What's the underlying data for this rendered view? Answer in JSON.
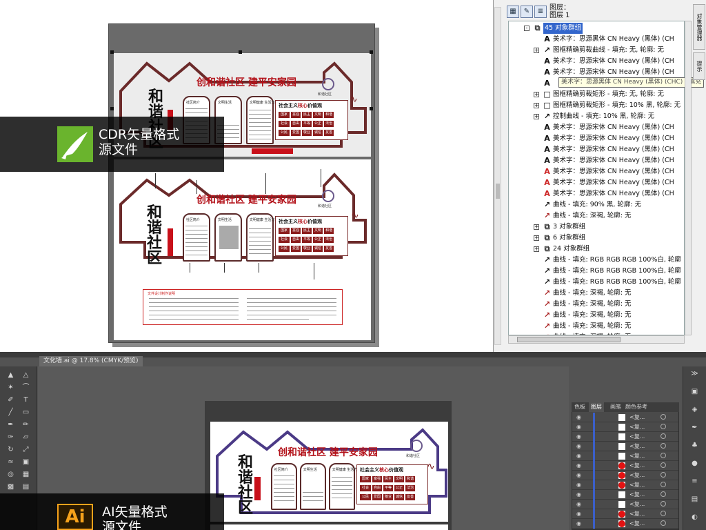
{
  "cdr": {
    "caption_line1": "CDR矢量格式",
    "caption_line2": "源文件"
  },
  "ai": {
    "caption_line1": "AI矢量格式",
    "caption_line2": "源文件",
    "doc_tab": "文化墙.ai @ 17.8% (CMYK/预览)",
    "logo": "Ai",
    "layers_tabs": [
      "色板",
      "图层",
      "画笔",
      "颜色参考"
    ],
    "layer_rows": [
      {
        "name": "<复...",
        "thumb": "white"
      },
      {
        "name": "<复...",
        "thumb": "white"
      },
      {
        "name": "<复...",
        "thumb": "white"
      },
      {
        "name": "<复...",
        "thumb": "white"
      },
      {
        "name": "<复...",
        "thumb": "white"
      },
      {
        "name": "<复...",
        "thumb": "red"
      },
      {
        "name": "<复...",
        "thumb": "red"
      },
      {
        "name": "<复...",
        "thumb": "red"
      },
      {
        "name": "<复...",
        "thumb": "white"
      },
      {
        "name": "<复...",
        "thumb": "white"
      },
      {
        "name": "<复...",
        "thumb": "red"
      },
      {
        "name": "<复...",
        "thumb": "red"
      }
    ]
  },
  "design": {
    "title": "创和谐社区 建平安家园",
    "brush_text": "和谐社区",
    "values_title_a": "社会主义",
    "values_title_b": "核心",
    "values_title_c": "价值观",
    "rows": [
      {
        "label": "国家",
        "cells": [
          "富强",
          "民主",
          "文明",
          "和谐"
        ]
      },
      {
        "label": "社会",
        "cells": [
          "自由",
          "平等",
          "公正",
          "法治"
        ]
      },
      {
        "label": "公民",
        "cells": [
          "爱国",
          "敬业",
          "诚信",
          "友善"
        ]
      }
    ],
    "logo_text": "和谐社区",
    "panel1_title": "社区简介",
    "panel2_title": "文明生活",
    "panel3_title": "文明健康 生活方式",
    "notes_title": "文件设计制作说明"
  },
  "objmgr": {
    "header_line1": "图层：",
    "header_line2": "图层 1",
    "tooltip": "美术字：思源黑体 CN Heavy (黑体) (CHC) - 填充",
    "vtab1": "对象管理器",
    "vtab2": "提示",
    "items": [
      {
        "indent": 0,
        "exp": "-",
        "icon": "group",
        "text": "45 对象群组",
        "selected": true
      },
      {
        "indent": 1,
        "exp": "",
        "icon": "A",
        "text": "美术字：思源黑体 CN Heavy (黑体) (CH"
      },
      {
        "indent": 1,
        "exp": "+",
        "icon": "curve",
        "text": "图框精确剪裁曲线 - 填充: 无, 轮廓: 无"
      },
      {
        "indent": 1,
        "exp": "",
        "icon": "A",
        "text": "美术字：思源宋体 CN Heavy (黑体) (CH"
      },
      {
        "indent": 1,
        "exp": "",
        "icon": "A",
        "text": "美术字：思源宋体 CN Heavy (黑体) (CH"
      },
      {
        "indent": 1,
        "exp": "",
        "icon": "A",
        "text": ""
      },
      {
        "indent": 1,
        "exp": "+",
        "icon": "rect",
        "text": "图框精确剪裁矩形 - 填充: 无, 轮廓: 无"
      },
      {
        "indent": 1,
        "exp": "+",
        "icon": "rect",
        "text": "图框精确剪裁矩形 - 填充: 10% 黑, 轮廓: 无"
      },
      {
        "indent": 1,
        "exp": "+",
        "icon": "curve",
        "text": "控制曲线 - 填充: 10% 黑, 轮廓: 无"
      },
      {
        "indent": 1,
        "exp": "",
        "icon": "A",
        "text": "美术字：思源宋体 CN Heavy (黑体) (CH"
      },
      {
        "indent": 1,
        "exp": "",
        "icon": "A",
        "text": "美术字：思源宋体 CN Heavy (黑体) (CH"
      },
      {
        "indent": 1,
        "exp": "",
        "icon": "A",
        "text": "美术字：思源宋体 CN Heavy (黑体) (CH"
      },
      {
        "indent": 1,
        "exp": "",
        "icon": "A",
        "text": "美术字：思源宋体 CN Heavy (黑体) (CH"
      },
      {
        "indent": 1,
        "exp": "",
        "icon": "A-red",
        "text": "美术字：思源宋体 CN Heavy (黑体) (CH"
      },
      {
        "indent": 1,
        "exp": "",
        "icon": "A-red",
        "text": "美术字：思源宋体 CN Heavy (黑体) (CH"
      },
      {
        "indent": 1,
        "exp": "",
        "icon": "A-red",
        "text": "美术字：思源宋体 CN Heavy (黑体) (CH"
      },
      {
        "indent": 1,
        "exp": "",
        "icon": "curve",
        "text": "曲线 - 填充: 90% 黑, 轮廓: 无"
      },
      {
        "indent": 1,
        "exp": "",
        "icon": "curve-red",
        "text": "曲线 - 填充: 深褐, 轮廓: 无"
      },
      {
        "indent": 1,
        "exp": "+",
        "icon": "group",
        "text": "3 对象群组"
      },
      {
        "indent": 1,
        "exp": "+",
        "icon": "group",
        "text": "6 对象群组"
      },
      {
        "indent": 1,
        "exp": "+",
        "icon": "group",
        "text": "24 对象群组"
      },
      {
        "indent": 1,
        "exp": "",
        "icon": "curve",
        "text": "曲线 - 填充: RGB RGB RGB 100%白, 轮廓"
      },
      {
        "indent": 1,
        "exp": "",
        "icon": "curve",
        "text": "曲线 - 填充: RGB RGB RGB 100%白, 轮廓"
      },
      {
        "indent": 1,
        "exp": "",
        "icon": "curve",
        "text": "曲线 - 填充: RGB RGB RGB 100%白, 轮廓"
      },
      {
        "indent": 1,
        "exp": "",
        "icon": "curve-red",
        "text": "曲线 - 填充: 深褐, 轮廓: 无"
      },
      {
        "indent": 1,
        "exp": "",
        "icon": "curve-red",
        "text": "曲线 - 填充: 深褐, 轮廓: 无"
      },
      {
        "indent": 1,
        "exp": "",
        "icon": "curve-red",
        "text": "曲线 - 填充: 深褐, 轮廓: 无"
      },
      {
        "indent": 1,
        "exp": "",
        "icon": "curve-red",
        "text": "曲线 - 填充: 深褐, 轮廓: 无"
      },
      {
        "indent": 1,
        "exp": "",
        "icon": "curve-red",
        "text": "曲线 - 填充: 深褐, 轮廓: 无"
      }
    ]
  },
  "colors": {
    "accent_red": "#b3121a",
    "house_outline": "#6b2a2a",
    "ai_house_outline": "#4b3a86",
    "selection_blue": "#3366cc",
    "cdr_green": "#6ab42d",
    "ai_orange": "#f7a21b"
  }
}
